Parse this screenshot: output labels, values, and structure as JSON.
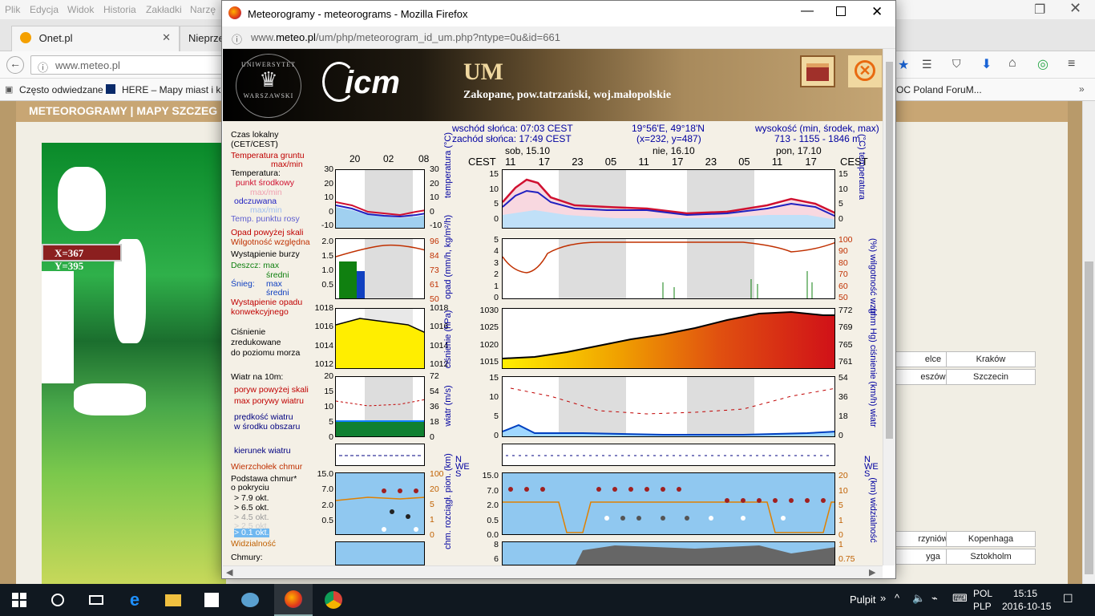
{
  "bg_browser": {
    "menu": [
      "Plik",
      "Edycja",
      "Widok",
      "Historia",
      "Zakładki",
      "Narzę"
    ],
    "tabs": [
      {
        "label": "Onet.pl"
      },
      {
        "label": "Nieprze"
      }
    ],
    "url": "www.meteo.pl",
    "bookmarks": [
      "Często odwiedzane",
      "HERE – Mapy miast i k...",
      "OC Poland ForuM..."
    ],
    "site_nav": "METEOROGRAMY  |  MAPY SZCZEG",
    "coord": "X=367 Y=395",
    "cities": [
      "elce",
      "Kraków",
      "eszów",
      "Szczecin",
      "rzyniów",
      "Kopenhaga",
      "yga",
      "Sztokholm"
    ]
  },
  "popup": {
    "title": "Meteorogramy - meteorograms - Mozilla Firefox",
    "url_prefix": "www.",
    "url_domain": "meteo.pl",
    "url_rest": "/um/php/meteorogram_id_um.php?ntype=0u&id=661",
    "header": {
      "model": "UM",
      "location": "Zakopane, pow.tatrzański, woj.małopolskie",
      "univ_top": "UNIWERSYTET",
      "univ_bottom": "WARSZAWSKI",
      "icm": "icm"
    },
    "info": {
      "sunrise": "wschód słońca: 07:03 CEST",
      "sunset": "zachód słońca: 17:49 CEST",
      "coords1": "19°56'E, 49°18'N",
      "coords2": "(x=232, y=487)",
      "elev1": "wysokość (min, środek, max)",
      "elev2": "713 - 1155 - 1846 m"
    },
    "legend": {
      "czas1": "Czas lokalny",
      "czas2": "(CET/CEST)",
      "tgrunt1": "Temperatura gruntu",
      "tgrunt2": "max/min",
      "temp": "Temperatura:",
      "punkt": "punkt środkowy",
      "maxmin1": "max/min",
      "odcz": "odczuwana",
      "maxmin2": "max/min",
      "rosa": "Temp. punktu rosy",
      "opad": "Opad powyżej skali",
      "wilg": "Wilgotność względna",
      "burza": "Wystąpienie burzy",
      "deszcz": "Deszcz:  max",
      "sredni1": "średni",
      "snieg": "Śnieg:",
      "max": "max",
      "sredni2": "średni",
      "konw1": "Wystąpienie opadu",
      "konw2": "konwekcyjnego",
      "cisn1": "Ciśnienie",
      "cisn2": "zredukowane",
      "cisn3": "do poziomu morza",
      "wiatr": "Wiatr na 10m:",
      "poryw1": "poryw powyżej skali",
      "poryw2": "max porywy wiatru",
      "predk1": "prędkość wiatru",
      "predk2": "w środku obszaru",
      "kier": "kierunek wiatru",
      "wierz": "Wierzchołek chmur",
      "podst1": "Podstawa chmur*",
      "podst2": "o pokryciu",
      "ok1": "> 7.9 okt.",
      "ok2": "> 6.5 okt.",
      "ok3": "> 4.5 okt.",
      "ok4": "> 2.5 okt.",
      "ok5": "> 0.1 okt.",
      "widz": "Widzialność",
      "chmury": "Chmury:"
    },
    "small_times": [
      "20",
      "02",
      "08"
    ],
    "days": [
      "sob, 15.10",
      "nie, 16.10",
      "pon, 17.10"
    ],
    "cest": "CEST",
    "hours": [
      "11",
      "17",
      "23",
      "05",
      "11",
      "17",
      "23",
      "05",
      "11",
      "17"
    ],
    "axes": {
      "temp_l": [
        "15",
        "10",
        "5",
        "0"
      ],
      "temp_r": [
        "15",
        "10",
        "5",
        "0"
      ],
      "temp_lbl_l": "temperatura (°C)",
      "temp_lbl_r": "(°C) temperatura",
      "st_l": [
        "30",
        "20",
        "10",
        "0",
        "-10"
      ],
      "st_r": [
        "30",
        "20",
        "10",
        "0",
        "-10"
      ],
      "opad_l": [
        "5",
        "4",
        "3",
        "2",
        "1",
        "0"
      ],
      "opad_r": [
        "100",
        "90",
        "80",
        "70",
        "60",
        "50"
      ],
      "opad_lbl_l": "opad (mm/h, kg/m²/h)",
      "opad_lbl_r": "(%) wilgotność wzgl.",
      "so_l": [
        "2.0",
        "1.5",
        "1.0",
        "0.5"
      ],
      "so_r": [
        "96",
        "84",
        "73",
        "61",
        "50"
      ],
      "cisn_l": [
        "1030",
        "1025",
        "1020",
        "1015"
      ],
      "cisn_r": [
        "772",
        "769",
        "765",
        "761"
      ],
      "cisn_lbl_l": "ciśnienie (hPa)",
      "cisn_lbl_r": "(mm Hg) ciśnienie",
      "sc_l": [
        "1018",
        "1016",
        "1014",
        "1012"
      ],
      "sc_r": [
        "1018",
        "1016",
        "1014",
        "1012"
      ],
      "wiatr_l": [
        "15",
        "10",
        "5",
        "0"
      ],
      "wiatr_r": [
        "54",
        "36",
        "18",
        "0"
      ],
      "wiatr_lbl_l": "wiatr (m/s)",
      "wiatr_lbl_r": "(km/h) wiatr",
      "sw_l": [
        "20",
        "15",
        "10",
        "5",
        "0"
      ],
      "sw_r": [
        "72",
        "54",
        "36",
        "18",
        "0"
      ],
      "chm_l": [
        "15.0",
        "7.0",
        "2.0",
        "0.5",
        "0.0"
      ],
      "chm_r": [
        "20",
        "10",
        "5",
        "1",
        "0"
      ],
      "chm_lbl_l": "chm. rozciągł. pion. (km)",
      "chm_lbl_r": "(km) widzialność",
      "sch_l": [
        "15.0",
        "7.0",
        "2.0",
        "0.5"
      ],
      "sch_r": [
        "100",
        "20",
        "5",
        "1",
        "0"
      ],
      "last_l": [
        "8",
        "6"
      ],
      "last_r": [
        "1",
        "0.75"
      ],
      "compass": [
        "N",
        "W",
        "E",
        "S"
      ]
    }
  },
  "taskbar": {
    "pulpit": "Pulpit",
    "lang1": "POL",
    "lang2": "PLP",
    "time": "15:15",
    "date": "2016-10-15"
  },
  "colors": {
    "temp_red": "#d01030",
    "temp_blue": "#2020c0",
    "pressure_high": "#d01018",
    "pressure_low": "#ffee00",
    "wind_blue": "#1080ff",
    "cloud_sky": "#90c8f0"
  }
}
